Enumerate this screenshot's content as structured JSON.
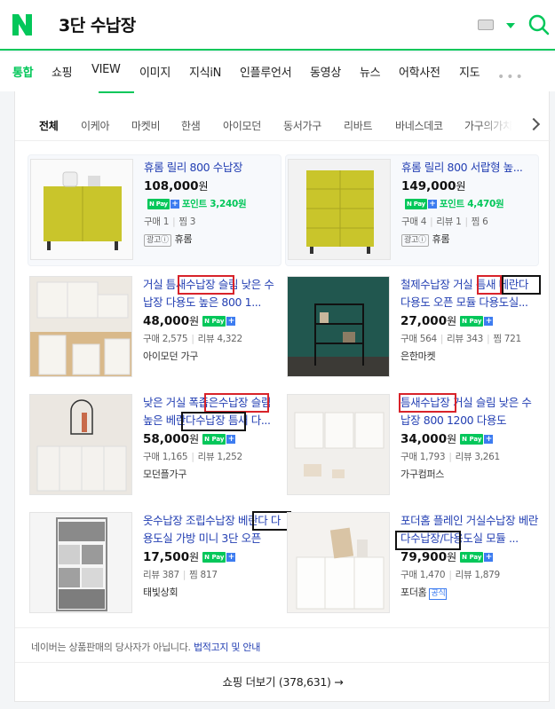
{
  "header": {
    "query": "3단 수납장",
    "brand_color": "#03c75a"
  },
  "nav": {
    "items": [
      "통합",
      "쇼핑",
      "VIEW",
      "이미지",
      "지식iN",
      "인플루언서",
      "동영상",
      "뉴스",
      "어학사전",
      "지도"
    ],
    "more": "•••"
  },
  "filters": [
    "전체",
    "이케아",
    "마켓비",
    "한샘",
    "아이모던",
    "동서가구",
    "리바트",
    "바네스데코",
    "가구의가치"
  ],
  "products": [
    {
      "title": "휴롬 릴리 800 수납장",
      "price": "108,000",
      "currency": "원",
      "npay": true,
      "point": "포인트 3,240원",
      "meta": [
        "구매 1",
        "찜 3"
      ],
      "ad": "광고ⓘ",
      "seller": "휴롬"
    },
    {
      "title": "휴롬 릴리 800 서랍형 높...",
      "price": "149,000",
      "currency": "원",
      "npay": true,
      "point": "포인트 4,470원",
      "meta": [
        "구매 4",
        "리뷰 1",
        "찜 6"
      ],
      "ad": "광고ⓘ",
      "seller": "휴롬"
    },
    {
      "title": "거실 틈새수납장 슬림 낮은 수납장 다용도 높은 800 1...",
      "price": "48,000",
      "currency": "원",
      "npay": true,
      "meta": [
        "구매 2,575",
        "리뷰 4,322"
      ],
      "seller": "아이모던 가구"
    },
    {
      "title": "철제수납장 거실 틈새 베란다 다용도 오픈 모듈 다용도실...",
      "price": "27,000",
      "currency": "원",
      "npay": true,
      "meta": [
        "구매 564",
        "리뷰 343",
        "찜 721"
      ],
      "seller": "은한마켓"
    },
    {
      "title": "낮은 거실 폭좁은수납장 슬림 높은 베란다수납장 틈새 다...",
      "price": "58,000",
      "currency": "원",
      "npay": true,
      "meta": [
        "구매 1,165",
        "리뷰 1,252"
      ],
      "seller": "모던플가구"
    },
    {
      "title": "틈새수납장 거실 슬림 낮은 수납장 800 1200 다용도",
      "price": "34,000",
      "currency": "원",
      "npay": true,
      "meta": [
        "구매 1,793",
        "리뷰 3,261"
      ],
      "seller": "가구컴퍼스"
    },
    {
      "title": "옷수납장 조립수납장 베란다 다용도실 가방 미니 3단 오픈",
      "price": "17,500",
      "currency": "원",
      "npay": true,
      "meta": [
        "리뷰 387",
        "찜 817"
      ],
      "seller": "태빛상회"
    },
    {
      "title": "포더홈 플레인 거실수납장 베란다수납장/다용도실 모듈 ...",
      "price": "79,900",
      "currency": "원",
      "npay": true,
      "meta": [
        "구매 1,470",
        "리뷰 1,879"
      ],
      "seller": "포더홈",
      "official": "공식"
    }
  ],
  "notice": {
    "text": "네이버는 상품판매의 당사자가 아닙니다.",
    "link": "법적고지 및 안내"
  },
  "more": {
    "label": "쇼핑 더보기 (378,631)",
    "arrow": "→"
  }
}
